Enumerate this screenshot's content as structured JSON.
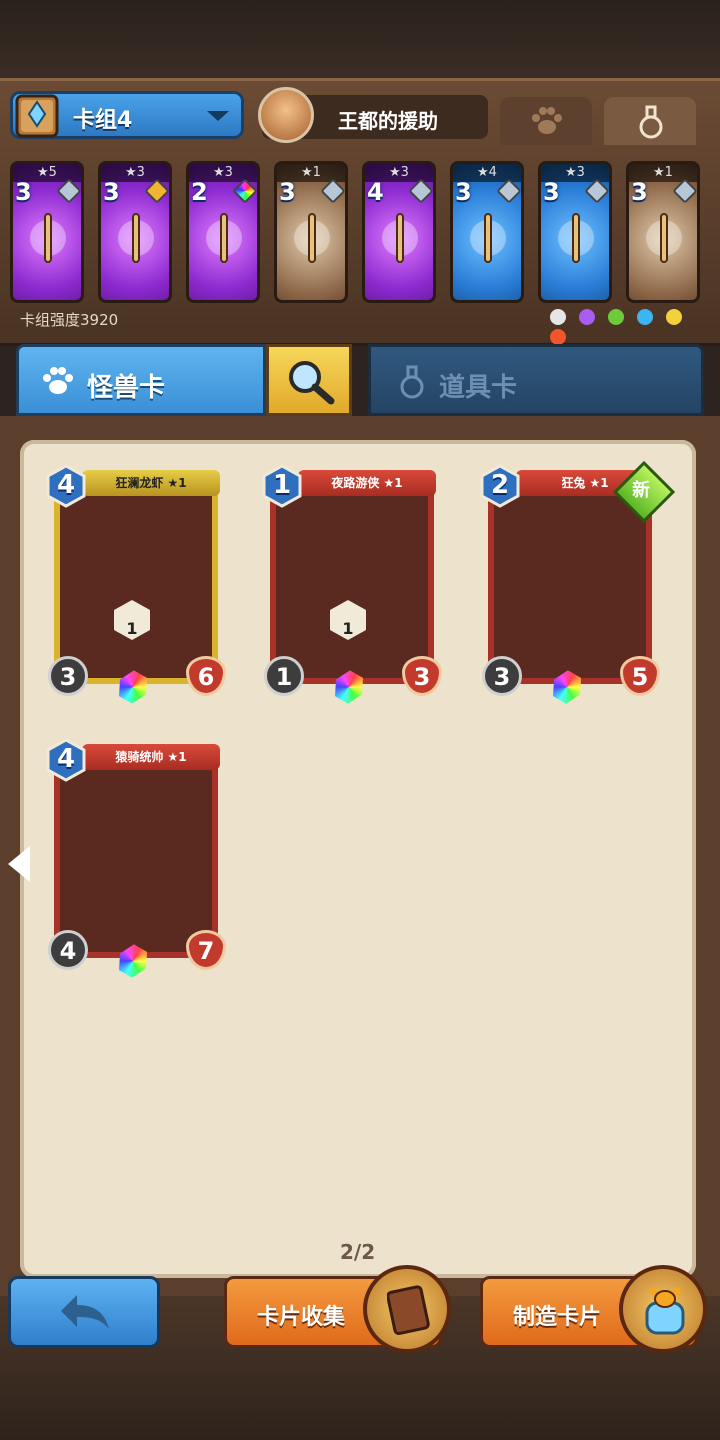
{
  "deck": {
    "name": "卡组4",
    "helper_title": "王都的援助",
    "power_label": "卡组强度3920",
    "cards": [
      {
        "stars": "★5",
        "cost": "3",
        "color": "purple",
        "gem": "silver",
        "art": "staff-icon"
      },
      {
        "stars": "★3",
        "cost": "3",
        "color": "purple",
        "gem": "gold",
        "art": "wing-helm-icon"
      },
      {
        "stars": "★3",
        "cost": "2",
        "color": "purple",
        "gem": "rainbow",
        "art": "feather-icon"
      },
      {
        "stars": "★1",
        "cost": "3",
        "color": "brown",
        "gem": "silver",
        "art": "bomb-icon"
      },
      {
        "stars": "★3",
        "cost": "4",
        "color": "purple",
        "gem": "silver",
        "art": "sword-icon"
      },
      {
        "stars": "★4",
        "cost": "3",
        "color": "blue",
        "gem": "silver",
        "art": "helmet-icon"
      },
      {
        "stars": "★3",
        "cost": "3",
        "color": "blue",
        "gem": "silver",
        "art": "flute-icon"
      },
      {
        "stars": "★1",
        "cost": "3",
        "color": "brown",
        "gem": "silver",
        "art": "potion-icon"
      }
    ]
  },
  "tabs": {
    "monster": "怪兽卡",
    "item": "道具卡"
  },
  "collection": [
    {
      "name": "狂澜龙虾 ★1",
      "cost": "4",
      "attack": "3",
      "health": "6",
      "ability": "1",
      "frame": "gold",
      "new": false
    },
    {
      "name": "夜路游侠 ★1",
      "cost": "1",
      "attack": "1",
      "health": "3",
      "ability": "1",
      "frame": "red",
      "new": false
    },
    {
      "name": "狂兔 ★1",
      "cost": "2",
      "attack": "3",
      "health": "5",
      "ability": "",
      "frame": "red",
      "new": true
    },
    {
      "name": "猿骑统帅 ★1",
      "cost": "4",
      "attack": "4",
      "health": "7",
      "ability": "",
      "frame": "red",
      "new": false
    }
  ],
  "new_label": "新",
  "page_indicator": "2/2",
  "buttons": {
    "collection": "卡片收集",
    "craft": "制造卡片"
  },
  "colors": {
    "tab_blue": "#3b8fd6",
    "button_orange": "#e06a1c",
    "paper": "#ede2cb"
  }
}
